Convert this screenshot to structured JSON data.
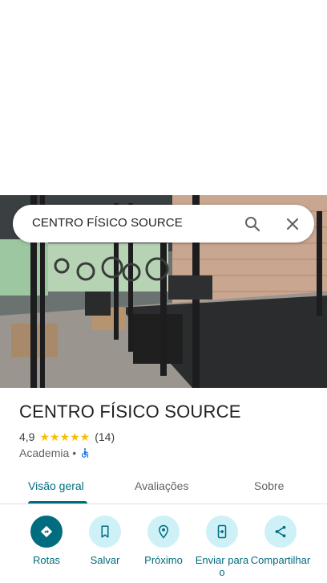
{
  "search": {
    "query": "CENTRO FÍSICO SOURCE"
  },
  "place": {
    "name": "CENTRO FÍSICO SOURCE",
    "rating": "4,9",
    "stars": "★★★★★",
    "review_count": "(14)",
    "category": "Academia",
    "separator": "•",
    "accessibility_icon": "wheelchair-icon"
  },
  "tabs": [
    {
      "label": "Visão geral",
      "active": true
    },
    {
      "label": "Avaliações",
      "active": false
    },
    {
      "label": "Sobre",
      "active": false
    }
  ],
  "actions": [
    {
      "label": "Rotas",
      "icon": "directions-icon"
    },
    {
      "label": "Salvar",
      "icon": "bookmark-icon"
    },
    {
      "label": "Próximo",
      "icon": "nearby-icon"
    },
    {
      "label": "Enviar para o",
      "icon": "send-to-phone-icon"
    },
    {
      "label": "Compartilhar",
      "icon": "share-icon"
    }
  ],
  "colors": {
    "accent": "#006c7f",
    "action_bg": "#cdf1f6",
    "star": "#fbbc04"
  }
}
